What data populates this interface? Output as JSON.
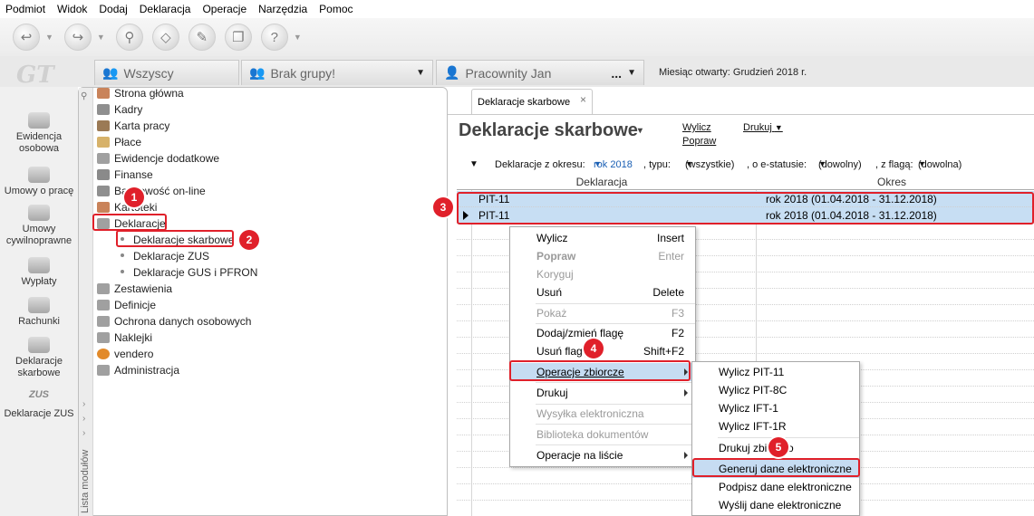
{
  "menubar": [
    "Podmiot",
    "Widok",
    "Dodaj",
    "Deklaracja",
    "Operacje",
    "Narzędzia",
    "Pomoc"
  ],
  "toolbar": {
    "buttons": [
      "back-icon",
      "forward-icon",
      "stamp-icon",
      "eraser-icon",
      "tools-icon",
      "copy-icon",
      "help-icon"
    ]
  },
  "groupbar": {
    "logo": "GT",
    "tab_all": "Wszyscy",
    "tab_group": "Brak grupy!",
    "tab_employee": "Pracownity Jan",
    "employee_more": "...",
    "month_open": "Miesiąc otwarty: Grudzień 2018 r."
  },
  "modules": [
    {
      "label": "Ewidencja osobowa"
    },
    {
      "label": "Umowy o pracę"
    },
    {
      "label": "Umowy cywilnoprawne"
    },
    {
      "label": "Wypłaty"
    },
    {
      "label": "Rachunki"
    },
    {
      "label": "Deklaracje skarbowe"
    },
    {
      "label": "Deklaracje ZUS"
    }
  ],
  "modules_zus_tag": "ZUS",
  "sidestrip_label": "Lista modułów",
  "tree": [
    "Strona główna",
    "Kadry",
    "Karta pracy",
    "Płace",
    "Ewidencje dodatkowe",
    "Finanse",
    "Bankowość on-line",
    "Kartoteki",
    "Deklaracje"
  ],
  "tree_sub": [
    "Deklaracje skarbowe",
    "Deklaracje ZUS",
    "Deklaracje GUS i PFRON"
  ],
  "tree_rest": [
    "Zestawienia",
    "Definicje",
    "Ochrona danych osobowych",
    "Naklejki",
    "vendero",
    "Administracja"
  ],
  "doc": {
    "tab_label": "Deklaracje skarbowe",
    "tab_close": "×",
    "title": "Deklaracje skarbowe",
    "title_drop": "▾",
    "link_wylicz": "Wylicz",
    "link_popraw": "Popraw",
    "link_drukuj": "Drukuj",
    "filter_prefix": "Deklaracje z okresu:",
    "filter_period": "rok 2018",
    "filter_type_label": ", typu:",
    "filter_type": "(wszystkie)",
    "filter_status_label": ", o e-statusie:",
    "filter_status": "(dowolny)",
    "filter_flag_label": ", z flagą:",
    "filter_flag": "(dowolna)"
  },
  "grid": {
    "col1": "Deklaracja",
    "col2": "Okres",
    "rows": [
      {
        "name": "PIT-11",
        "period": "rok 2018 (01.04.2018 - 31.12.2018)"
      },
      {
        "name": "PIT-11",
        "period": "rok 2018 (01.04.2018 - 31.12.2018)"
      }
    ]
  },
  "context_menu": [
    {
      "label": "Wylicz",
      "key": "Insert"
    },
    {
      "label": "Popraw",
      "key": "Enter"
    },
    {
      "label": "Koryguj",
      "key": ""
    },
    {
      "label": "Usuń",
      "key": "Delete"
    },
    {
      "label": "Pokaż",
      "key": "F3"
    },
    {
      "label": "Dodaj/zmień flagę",
      "key": "F2"
    },
    {
      "label": "Usuń flagę",
      "key": "Shift+F2"
    },
    {
      "label": "Operacje zbiorcze",
      "key": ""
    },
    {
      "label": "Drukuj",
      "key": ""
    },
    {
      "label": "Wysyłka elektroniczna",
      "key": ""
    },
    {
      "label": "Biblioteka dokumentów",
      "key": ""
    },
    {
      "label": "Operacje na liście",
      "key": ""
    }
  ],
  "submenu": [
    "Wylicz PIT-11",
    "Wylicz PIT-8C",
    "Wylicz IFT-1",
    "Wylicz IFT-1R",
    "Drukuj zbiorczo",
    "Generuj dane elektroniczne",
    "Podpisz dane elektroniczne",
    "Wyślij dane elektroniczne"
  ],
  "callouts": [
    "1",
    "2",
    "3",
    "4",
    "5"
  ],
  "colors": {
    "highlight": "#e0202a",
    "selection": "#c7def3",
    "link": "#1a5fb4"
  }
}
